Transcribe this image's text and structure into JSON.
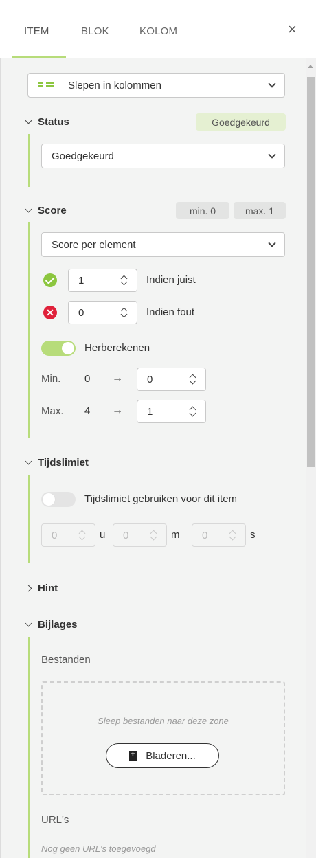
{
  "tabs": [
    {
      "label": "ITEM",
      "active": true
    },
    {
      "label": "BLOK",
      "active": false
    },
    {
      "label": "KOLOM",
      "active": false
    }
  ],
  "close_label": "×",
  "question_type": {
    "label": "Slepen in kolommen",
    "icon": "drag-columns-icon"
  },
  "status": {
    "title": "Status",
    "badge": "Goedgekeurd",
    "select_value": "Goedgekeurd"
  },
  "score": {
    "title": "Score",
    "min_badge": "min. 0",
    "max_badge": "max. 1",
    "method": "Score per element",
    "correct": {
      "value": "1",
      "label": "Indien juist"
    },
    "wrong": {
      "value": "0",
      "label": "Indien fout"
    },
    "recalc_label": "Herberekenen",
    "recalc_on": true,
    "min": {
      "label": "Min.",
      "from": "0",
      "arrow": "→",
      "to": "0"
    },
    "max": {
      "label": "Max.",
      "from": "4",
      "arrow": "→",
      "to": "1"
    }
  },
  "time_limit": {
    "title": "Tijdslimiet",
    "toggle_label": "Tijdslimiet gebruiken voor dit item",
    "enabled": false,
    "hours": "0",
    "hours_unit": "u",
    "minutes": "0",
    "minutes_unit": "m",
    "seconds": "0",
    "seconds_unit": "s"
  },
  "hint": {
    "title": "Hint"
  },
  "attachments": {
    "title": "Bijlages",
    "files_label": "Bestanden",
    "dropzone_text": "Sleep bestanden naar deze zone",
    "browse_label": "Bladeren...",
    "urls_label": "URL's",
    "urls_empty": "Nog geen URL's toegevoegd"
  },
  "colors": {
    "accent": "#b7dc7a",
    "badge_green": "#e5f0d2",
    "ok": "#8cc63f",
    "error": "#e0213a"
  }
}
